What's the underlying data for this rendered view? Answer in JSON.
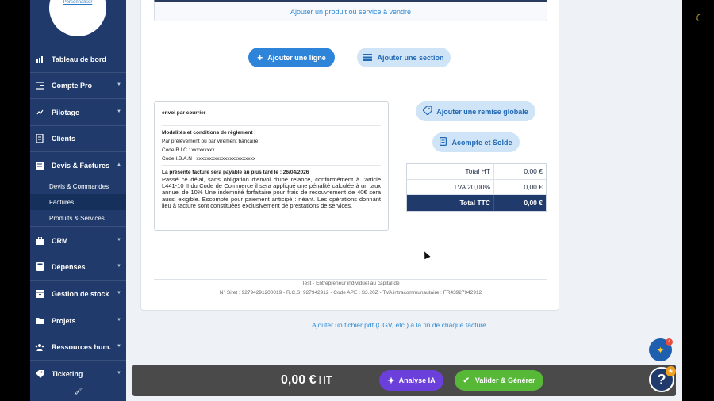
{
  "sidebar": {
    "logo_text": "logo",
    "logo_link": "Personnaliser",
    "items": [
      {
        "label": "Tableau de bord",
        "icon": "chart-bar-icon"
      },
      {
        "label": "Compte Pro",
        "icon": "bank-icon"
      },
      {
        "label": "Pilotage",
        "icon": "pilot-chart-icon"
      },
      {
        "label": "Clients",
        "icon": "clients-icon"
      },
      {
        "label": "Devis & Factures",
        "icon": "invoice-icon"
      },
      {
        "label": "CRM",
        "icon": "briefcase-icon"
      },
      {
        "label": "Dépenses",
        "icon": "calculator-icon"
      },
      {
        "label": "Gestion de stock",
        "icon": "stock-icon"
      },
      {
        "label": "Projets",
        "icon": "folder-icon"
      },
      {
        "label": "Ressources hum.",
        "icon": "users-icon"
      },
      {
        "label": "Ticketing",
        "icon": "ticket-icon"
      }
    ],
    "subitems": [
      "Devis & Commandes",
      "Factures",
      "Produits & Services"
    ]
  },
  "invoice": {
    "add_product": "Ajouter un produit ou service à vendre",
    "add_line": "Ajouter une ligne",
    "add_section": "Ajouter une section",
    "global_discount": "Ajouter une remise globale",
    "deposit": "Acompte et Solde",
    "terms": {
      "shipping": "envoi par courrier",
      "payment_title": "Modalités et conditions de règlement :",
      "payment_method": "Par prélèvement ou par virement bancaire",
      "bic": "Code B.I.C : xxxxxxxxx",
      "iban": "Code I.B.A.N : xxxxxxxxxxxxxxxxxxxxxxx",
      "due": "La présente facture sera payable au plus tard le : 26/04/2026",
      "legal": "Passé ce délai, sans obligation d'envoi d'une relance, conformément à l'article L441-10 II du Code de Commerce il sera appliqué une pénalité calculée à un taux annuel de 10% Une indemnité forfaitaire pour frais de recouvrement de 40€ sera aussi exigible. Escompte pour paiement anticipé : néant. Les opérations donnant lieu à facture sont constituées exclusivement de prestations de services."
    },
    "totals": [
      {
        "label": "Total HT",
        "value": "0,00 €"
      },
      {
        "label": "TVA 20,00%",
        "value": "0,00 €"
      },
      {
        "label": "Total TTC",
        "value": "0,00 €"
      }
    ],
    "footer_line1": "Test - Entrepreneur individuel au capital de",
    "footer_line2": "N° Siret : 92794291200019 - R.C.S. 927942912 - Code APE : S3.20Z - TVA intracommunautaire : FR43927942912",
    "pdf_link": "Ajouter un fichier pdf (CGV, etc.) à la fin de chaque facture"
  },
  "bottom": {
    "amount": "0,00 €",
    "unit": "HT",
    "ai": "Analyse IA",
    "validate": "Valider & Générer"
  },
  "widgets": {
    "badge_count": "4",
    "help": "?"
  },
  "colors": {
    "sidebar": "#1f3a6b",
    "primary": "#2e84d8",
    "ai": "#6b3fd9",
    "validate": "#57b838"
  }
}
